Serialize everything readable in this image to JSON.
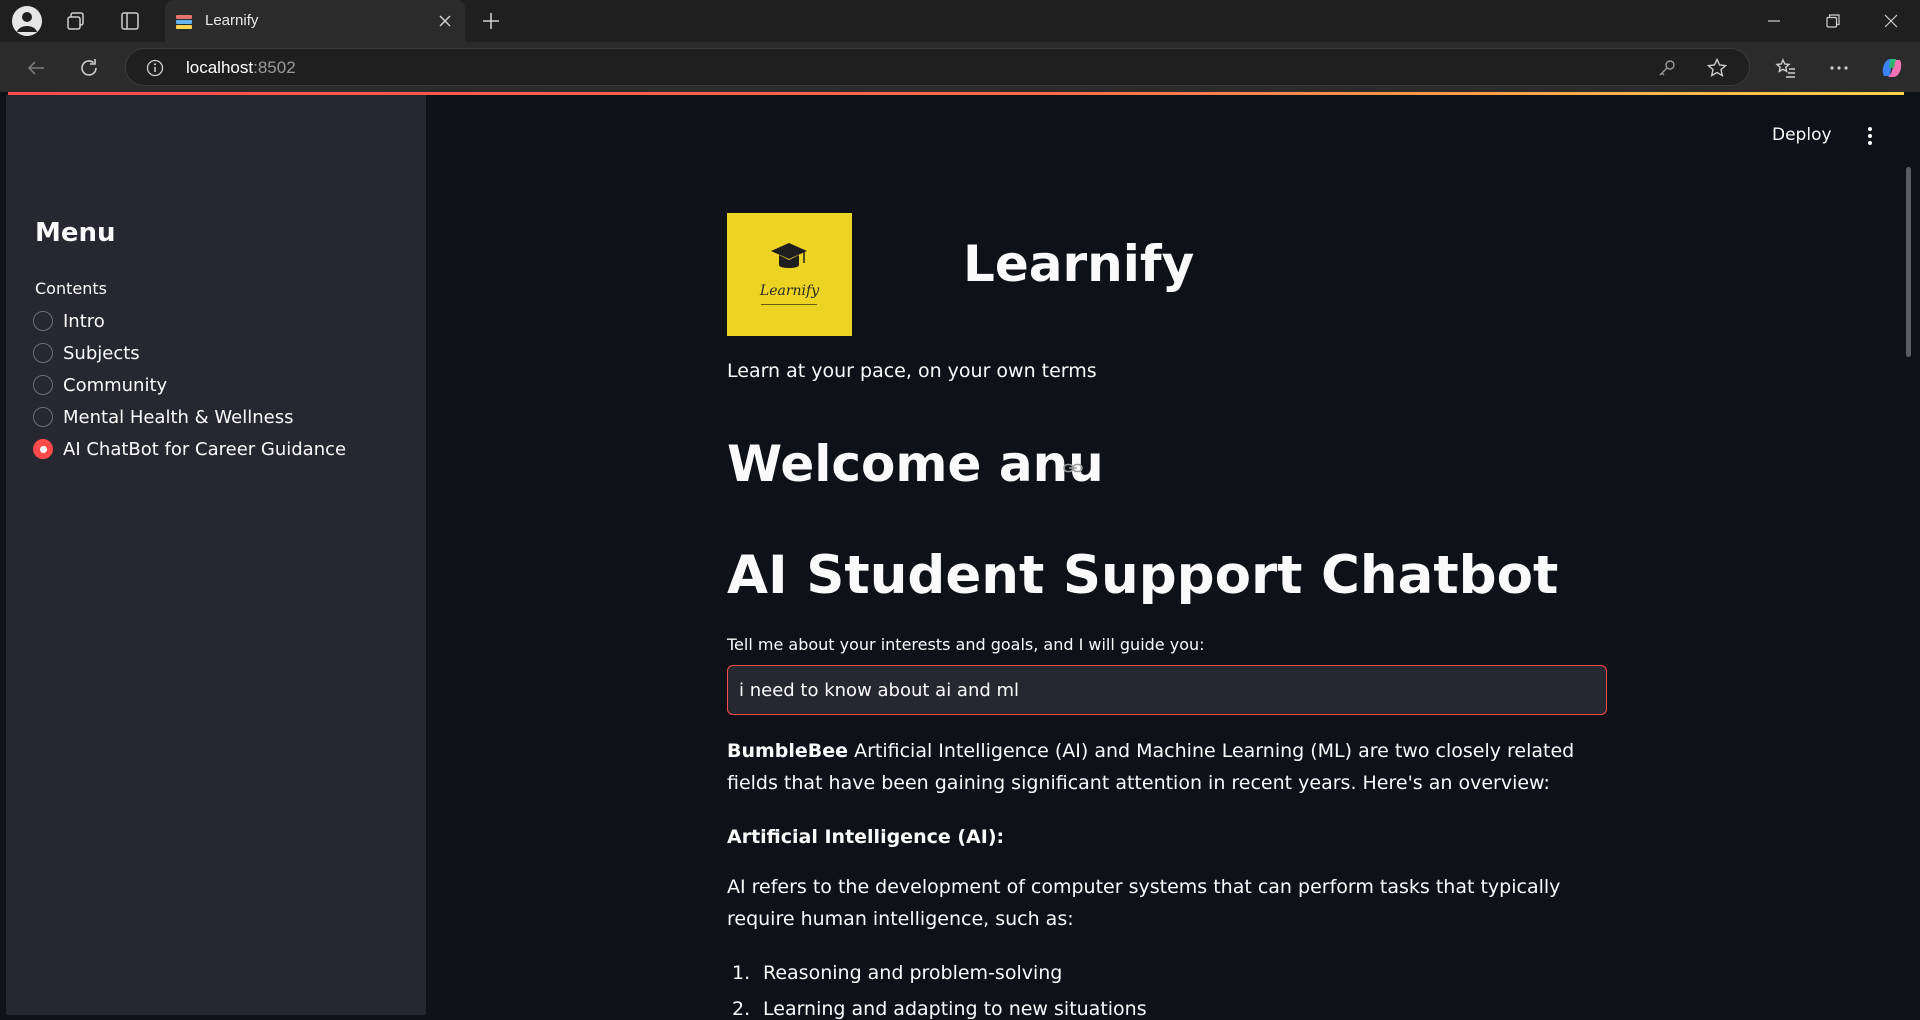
{
  "browser": {
    "tab_title": "Learnify",
    "url_host": "localhost",
    "url_port": ":8502"
  },
  "sidebar": {
    "title": "Menu",
    "label": "Contents",
    "items": [
      {
        "label": "Intro",
        "selected": false
      },
      {
        "label": "Subjects",
        "selected": false
      },
      {
        "label": "Community",
        "selected": false
      },
      {
        "label": "Mental Health & Wellness",
        "selected": false
      },
      {
        "label": "AI ChatBot for Career Guidance",
        "selected": true
      }
    ]
  },
  "header": {
    "deploy_label": "Deploy"
  },
  "main": {
    "logo_text": "Learnify",
    "brand_title": "Learnify",
    "tagline": "Learn at your pace, on your own terms",
    "welcome": "Welcome anu",
    "chat_title": "AI Student Support Chatbot",
    "input_label": "Tell me about your interests and goals, and I will guide you:",
    "input_value": "i need to know about ai and ml",
    "response": {
      "bot_name": "BumbleBee",
      "intro": "Artificial Intelligence (AI) and Machine Learning (ML) are two closely related fields that have been gaining significant attention in recent years. Here's an overview:",
      "heading": "Artificial Intelligence (AI):",
      "paragraph": "AI refers to the development of computer systems that can perform tasks that typically require human intelligence, such as:",
      "list": [
        {
          "num": "1.",
          "text": "Reasoning and problem-solving"
        },
        {
          "num": "2.",
          "text": "Learning and adapting to new situations"
        }
      ]
    }
  },
  "colors": {
    "accent": "#ff4b4b",
    "sidebar_bg": "#262730",
    "main_bg": "#0e1117",
    "logo_bg": "#ecd324"
  }
}
